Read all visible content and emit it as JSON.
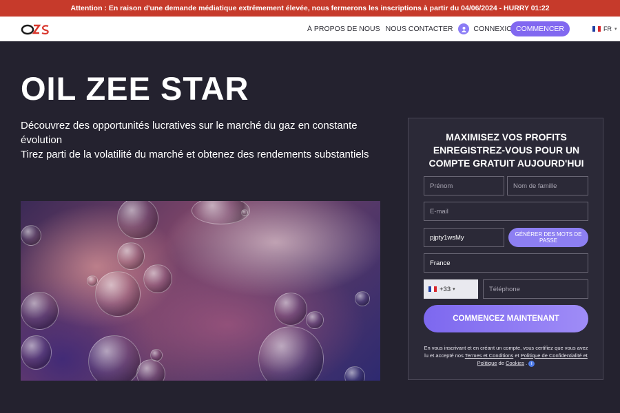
{
  "alert": {
    "text": "Attention : En raison d'une demande médiatique extrêmement élevée, nous fermerons les inscriptions à partir du 04/06/2024 - HURRY 01:22"
  },
  "nav": {
    "about": "À PROPOS DE NOUS",
    "contact": "NOUS CONTACTER",
    "login": "CONNEXION",
    "start": "COMMENCER",
    "lang": "FR"
  },
  "hero": {
    "title": "OIL ZEE STAR",
    "line1": "Découvrez des opportunités lucratives sur le marché du gaz en constante évolution",
    "line2": "Tirez parti de la volatilité du marché et obtenez des rendements substantiels"
  },
  "form": {
    "title_line1": "MAXIMISEZ VOS PROFITS",
    "title_line2": "ENREGISTREZ-VOUS POUR UN",
    "title_line3": "COMPTE GRATUIT AUJOURD'HUI",
    "first_name_placeholder": "Prénom",
    "last_name_placeholder": "Nom de famille",
    "email_placeholder": "E-mail",
    "password_value": "pjpty1wsMy",
    "generate_label": "GÉNÉRER DES MOTS DE PASSE",
    "country_value": "France",
    "dial_code": "+33",
    "phone_placeholder": "Téléphone",
    "submit_label": "COMMENCEZ MAINTENANT",
    "disclaimer_pre": "En vous inscrivant et en créant un compte, vous certifiez que vous avez lu et accepté nos ",
    "terms_link": "Termes et Conditions",
    "and1": " et ",
    "privacy_link": "Politique de Confidentialité et Politique",
    "and2": " de ",
    "cookies_link": "Cookies",
    "disclaimer_post": " ."
  },
  "colors": {
    "alert_bg": "#c63a2b",
    "accent": "#8168f0",
    "page_bg": "#24222f"
  }
}
